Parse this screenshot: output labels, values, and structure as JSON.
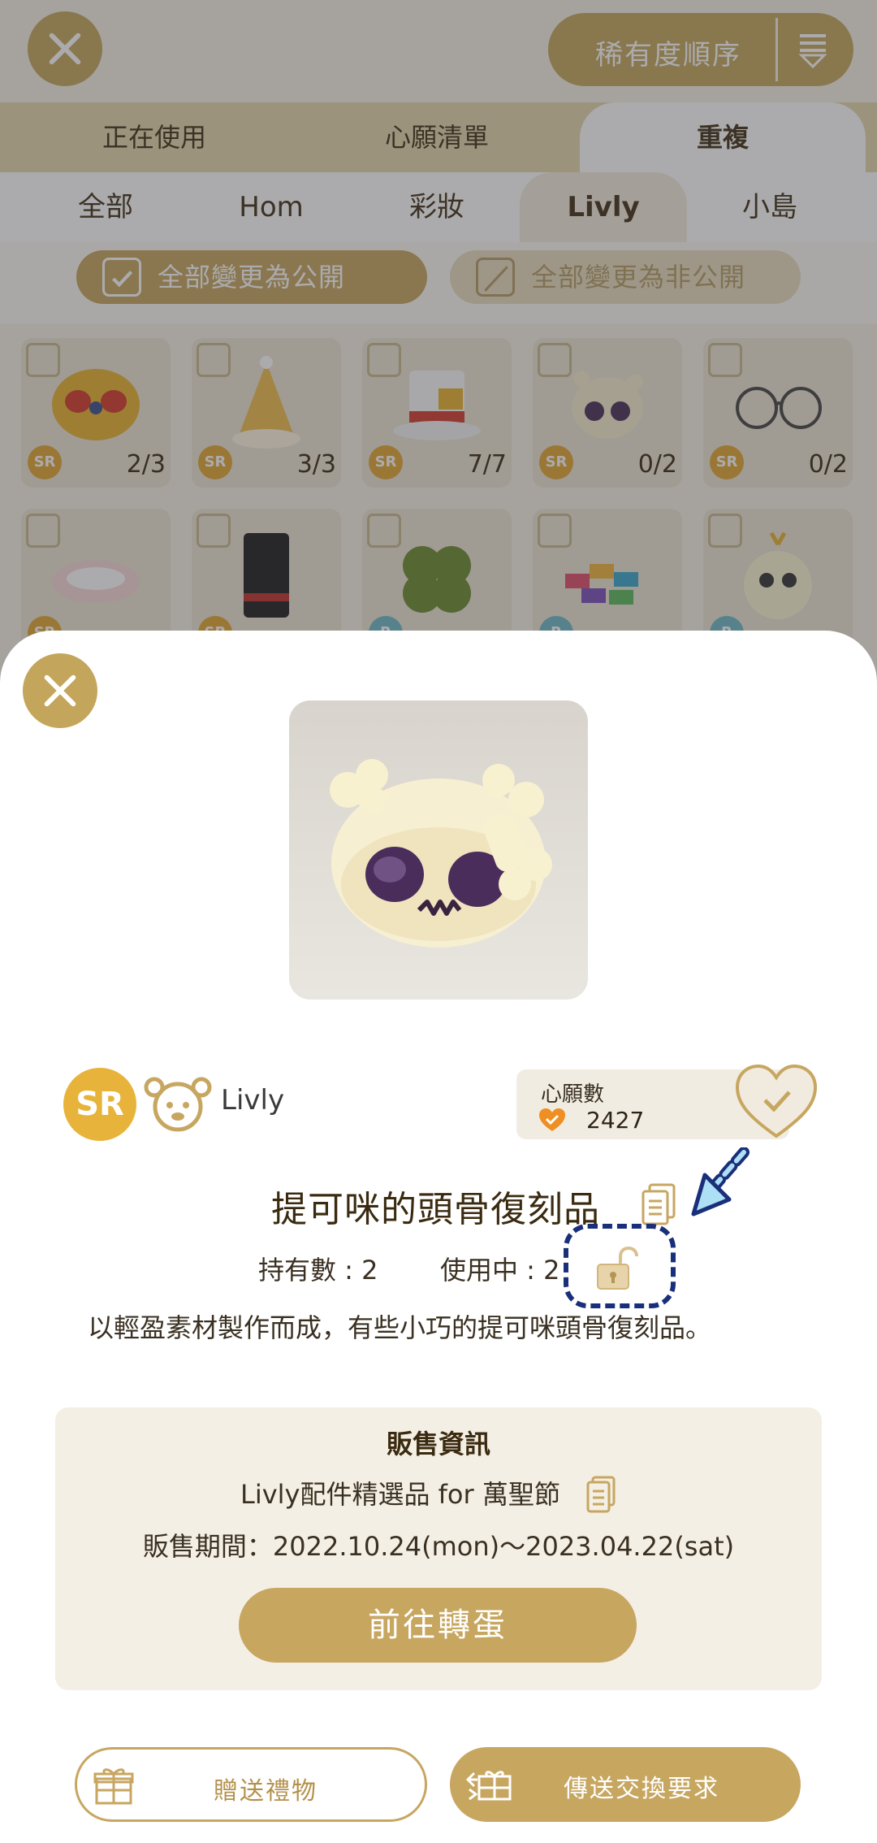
{
  "background": {
    "sort_label": "稀有度順序",
    "tabs": [
      "正在使用",
      "心願清單",
      "重複"
    ],
    "active_tab": "重複",
    "categories": [
      "全部",
      "Hom",
      "彩妝",
      "Livly",
      "小島"
    ],
    "active_category": "Livly",
    "make_public_label": "全部變更為公開",
    "make_private_label": "全部變更為非公開",
    "grid": [
      {
        "rarity": "SR",
        "count": "2/3",
        "icon": "lion-mask-icon"
      },
      {
        "rarity": "SR",
        "count": "3/3",
        "icon": "party-hat-icon"
      },
      {
        "rarity": "SR",
        "count": "7/7",
        "icon": "top-hat-icon"
      },
      {
        "rarity": "SR",
        "count": "0/2",
        "icon": "skull-icon"
      },
      {
        "rarity": "SR",
        "count": "0/2",
        "icon": "glasses-icon"
      },
      {
        "rarity": "SR",
        "count": "",
        "icon": "ring-icon"
      },
      {
        "rarity": "SR",
        "count": "",
        "icon": "black-top-hat-icon"
      },
      {
        "rarity": "R",
        "count": "",
        "icon": "clover-icon"
      },
      {
        "rarity": "R",
        "count": "",
        "icon": "candy-pile-icon"
      },
      {
        "rarity": "R",
        "count": "",
        "icon": "fluffy-creature-icon"
      }
    ]
  },
  "item": {
    "rarity": "SR",
    "category": "Livly",
    "wishlist_label": "心願數",
    "wishlist_count": "2427",
    "name": "提可咪的頭骨復刻品",
    "held": "持有數 : 2",
    "in_use": "使用中 : 2",
    "description": "以輕盈素材製作而成，有些小巧的提可咪頭骨復刻品。"
  },
  "sales": {
    "heading": "販售資訊",
    "collection": "Livly配件精選品 for 萬聖節",
    "period": "販售期間：2022.10.24(mon)～2023.04.22(sat)",
    "gacha_button": "前往轉蛋"
  },
  "actions": {
    "gift_label": "贈送禮物",
    "trade_label": "傳送交換要求"
  },
  "colors": {
    "accent": "#c7a660",
    "sr": "#e8b33a",
    "highlight": "#1a2f7a"
  }
}
